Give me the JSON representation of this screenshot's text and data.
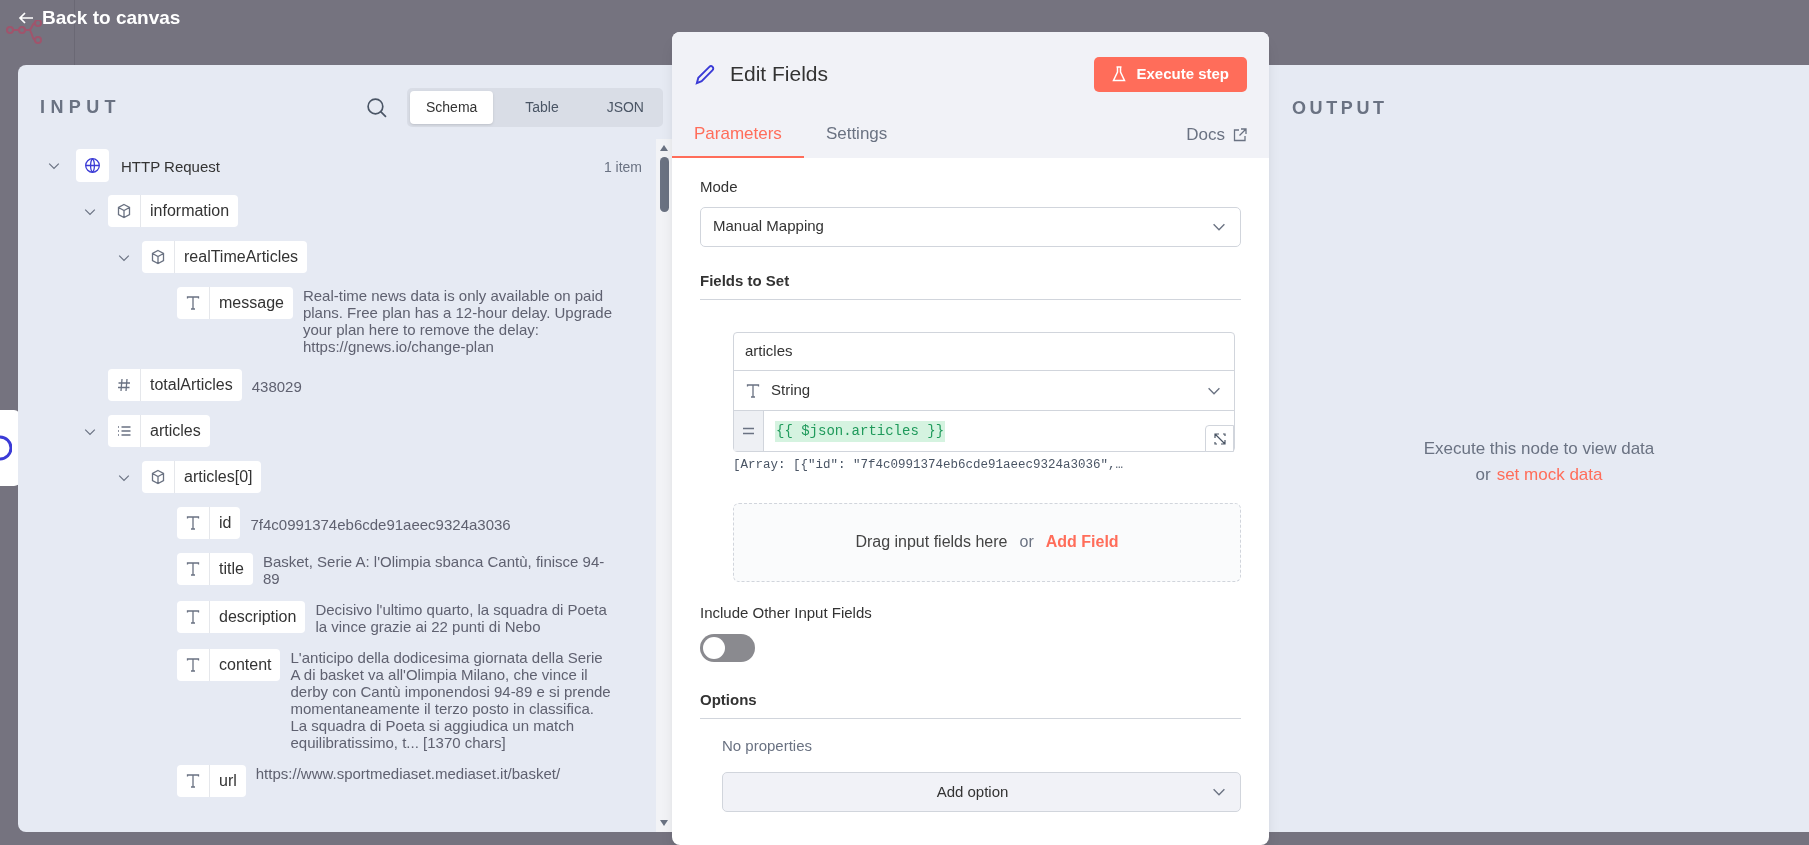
{
  "header": {
    "back_label": "Back to canvas"
  },
  "input": {
    "title": "INPUT",
    "view_tabs": [
      {
        "label": "Schema",
        "selected": true
      },
      {
        "label": "Table",
        "selected": false
      },
      {
        "label": "JSON",
        "selected": false
      }
    ],
    "tree": [
      {
        "kind": "root",
        "label": "HTTP Request",
        "count": "1 item",
        "expanded": true,
        "children": [
          {
            "kind": "object",
            "label": "information",
            "expanded": true,
            "children": [
              {
                "kind": "object",
                "label": "realTimeArticles",
                "expanded": true,
                "children": [
                  {
                    "kind": "string",
                    "label": "message",
                    "value": "Real-time news data is only available on paid plans. Free plan has a 12-hour delay. Upgrade your plan here to remove the delay: https://gnews.io/change-plan"
                  }
                ]
              }
            ]
          },
          {
            "kind": "number",
            "label": "totalArticles",
            "value": "438029"
          },
          {
            "kind": "array",
            "label": "articles",
            "expanded": true,
            "children": [
              {
                "kind": "object",
                "label": "articles[0]",
                "expanded": true,
                "children": [
                  {
                    "kind": "string",
                    "label": "id",
                    "value": "7f4c0991374eb6cde91aeec9324a3036"
                  },
                  {
                    "kind": "string",
                    "label": "title",
                    "value": "Basket, Serie A: l'Olimpia sbanca Cantù, finisce 94-89"
                  },
                  {
                    "kind": "string",
                    "label": "description",
                    "value": "Decisivo l'ultimo quarto, la squadra di Poeta la vince grazie ai 22 punti di Nebo"
                  },
                  {
                    "kind": "string",
                    "label": "content",
                    "value": "L'anticipo della dodicesima giornata della Serie A di basket va all'Olimpia Milano, che vince il derby con Cantù imponendosi 94-89 e si prende momentaneamente il terzo posto in classifica. La squadra di Poeta si aggiudica un match equilibratissimo, t... [1370 chars]"
                  },
                  {
                    "kind": "string",
                    "label": "url",
                    "value": "https://www.sportmediaset.mediaset.it/basket/"
                  }
                ]
              }
            ]
          }
        ]
      }
    ]
  },
  "node": {
    "title": "Edit Fields",
    "execute_label": "Execute step",
    "tabs": [
      {
        "label": "Parameters",
        "selected": true
      },
      {
        "label": "Settings",
        "selected": false
      }
    ],
    "docs_label": "Docs",
    "mode": {
      "label": "Mode",
      "value": "Manual Mapping"
    },
    "fields_to_set": {
      "label": "Fields to Set",
      "fields": [
        {
          "name": "articles",
          "type": "String",
          "expression": "{{ $json.articles }}",
          "preview": "[Array:  [{\"id\":  \"7f4c0991374eb6cde91aeec9324a3036\",…"
        }
      ],
      "drop_hint": "Drag input fields here",
      "or": "or",
      "add_field": "Add Field"
    },
    "include_other": {
      "label": "Include Other Input Fields",
      "on": false
    },
    "options": {
      "label": "Options",
      "empty": "No properties",
      "add_label": "Add option"
    }
  },
  "output": {
    "title": "OUTPUT",
    "message": "Execute this node to view data",
    "or": "or",
    "link": "set mock data"
  }
}
